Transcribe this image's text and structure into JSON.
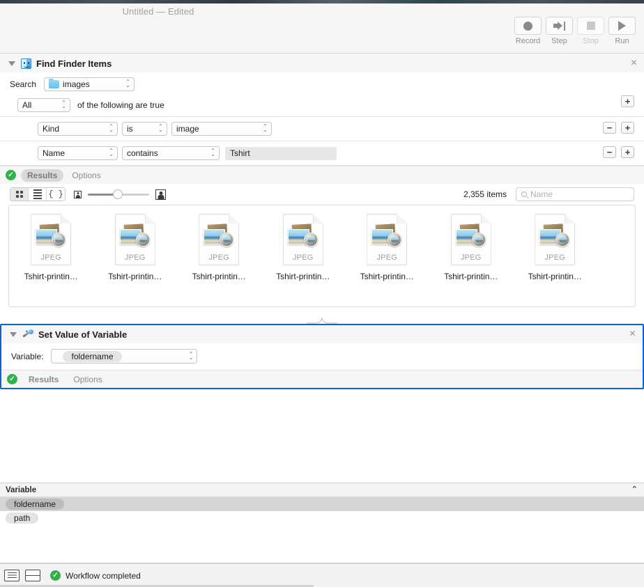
{
  "window": {
    "title": "Untitled — Edited"
  },
  "toolbar": {
    "buttons": [
      {
        "label": "Record",
        "icon": "record-circle-icon",
        "disabled": false
      },
      {
        "label": "Step",
        "icon": "step-arrow-icon",
        "disabled": false
      },
      {
        "label": "Stop",
        "icon": "stop-square-icon",
        "disabled": true
      },
      {
        "label": "Run",
        "icon": "run-triangle-icon",
        "disabled": false
      }
    ]
  },
  "actions": [
    {
      "title": "Find Finder Items",
      "icon": "finder-face-icon",
      "close_label": "✕",
      "search_label": "Search",
      "search_value": "images",
      "match_mode": "All",
      "match_suffix": "of the following are true",
      "add_label": "+",
      "remove_label": "−",
      "criteria": [
        {
          "attribute": "Kind",
          "operator": "is",
          "value": "image",
          "value_type": "popup"
        },
        {
          "attribute": "Name",
          "operator": "contains",
          "value": "Tshirt",
          "value_type": "text"
        }
      ],
      "tabs": [
        {
          "label": "Results",
          "selected": true
        },
        {
          "label": "Options",
          "selected": false
        }
      ],
      "results": {
        "view_modes": [
          {
            "icon": "grid-view-icon",
            "selected": true
          },
          {
            "icon": "list-view-icon",
            "selected": false
          },
          {
            "icon": "code-view-icon",
            "selected": false
          }
        ],
        "size_small_icon": "small-preview-icon",
        "size_large_icon": "large-preview-icon",
        "item_count": "2,355 items",
        "search_placeholder": "Name",
        "items": [
          {
            "name": "Tshirt-printin…",
            "kind": "JPEG"
          },
          {
            "name": "Tshirt-printin…",
            "kind": "JPEG"
          },
          {
            "name": "Tshirt-printin…",
            "kind": "JPEG"
          },
          {
            "name": "Tshirt-printin…",
            "kind": "JPEG"
          },
          {
            "name": "Tshirt-printin…",
            "kind": "JPEG"
          },
          {
            "name": "Tshirt-printin…",
            "kind": "JPEG"
          },
          {
            "name": "Tshirt-printin…",
            "kind": "JPEG"
          }
        ]
      }
    },
    {
      "title": "Set Value of Variable",
      "icon": "magic-wand-icon",
      "close_label": "✕",
      "variable_label": "Variable:",
      "variable_value": "foldername",
      "selected": true,
      "tabs": [
        {
          "label": "Results",
          "selected": false
        },
        {
          "label": "Options",
          "selected": false
        }
      ]
    }
  ],
  "variable_panel": {
    "header": "Variable",
    "collapse_icon": "chevron-up-icon",
    "rows": [
      {
        "name": "foldername",
        "selected": true
      },
      {
        "name": "path",
        "selected": false
      }
    ]
  },
  "statusbar": {
    "log_icon": "log-view-icon",
    "split_icon": "split-view-icon",
    "status_text": "Workflow completed",
    "status_icon": "success-check-icon"
  },
  "colors": {
    "selection_blue": "#0a63d6",
    "success_green": "#31b14b",
    "toolbar_bg": "#f6f6f6"
  }
}
